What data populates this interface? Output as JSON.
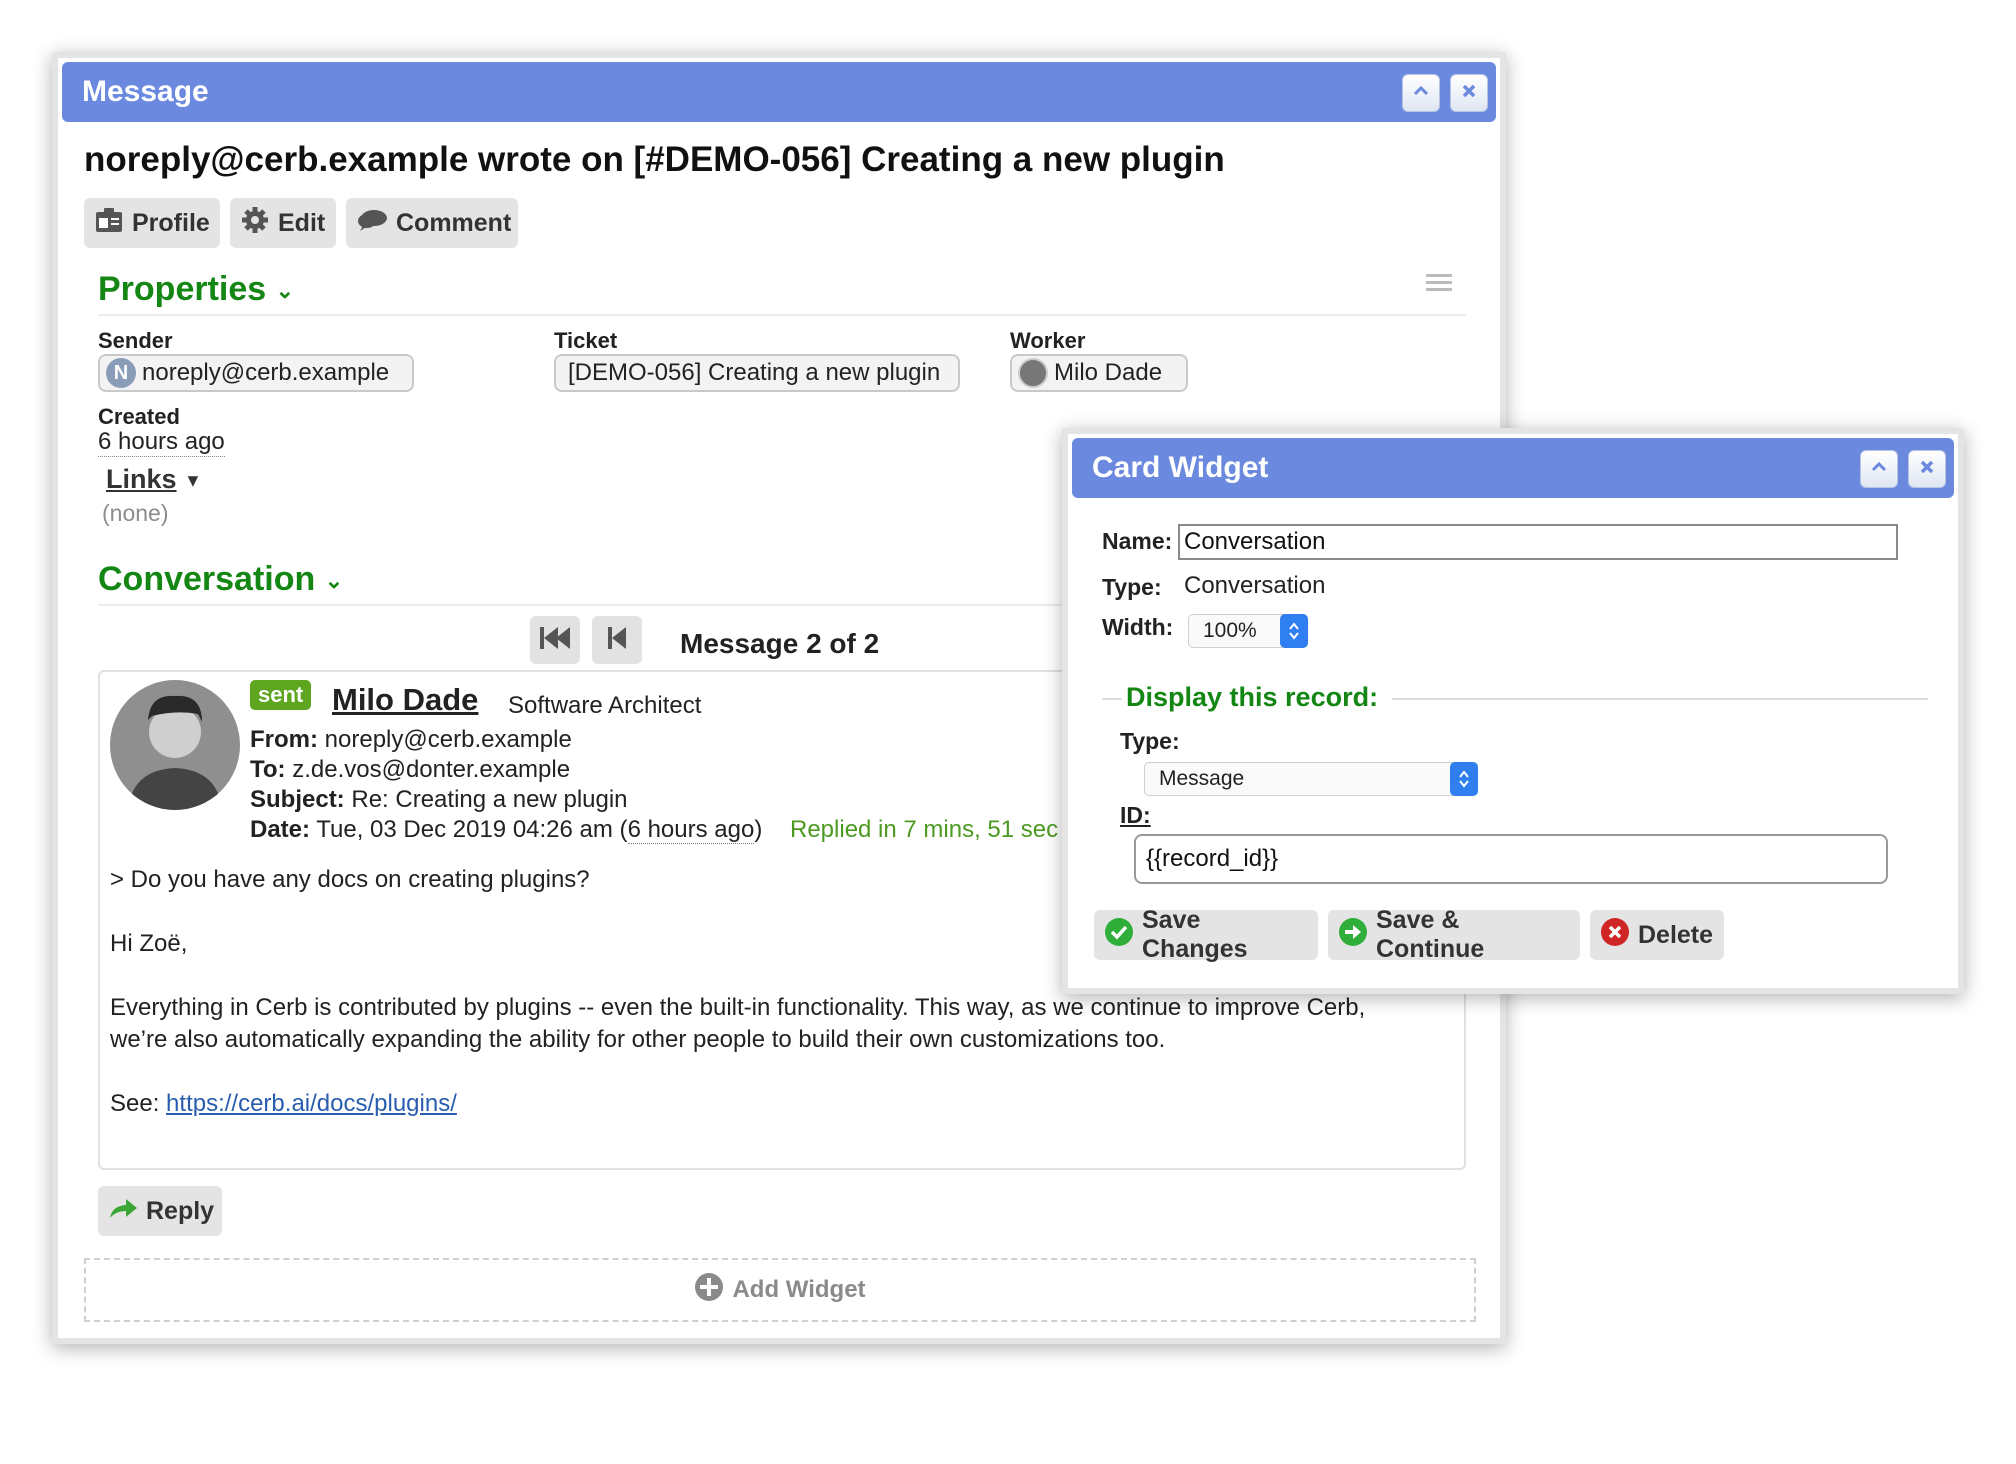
{
  "message_dialog": {
    "title": "Message",
    "heading": "noreply@cerb.example wrote on [#DEMO-056] Creating a new plugin",
    "toolbar": {
      "profile": "Profile",
      "edit": "Edit",
      "comment": "Comment"
    },
    "properties": {
      "section_title": "Properties",
      "sender_label": "Sender",
      "sender_value": "noreply@cerb.example",
      "sender_initial": "N",
      "ticket_label": "Ticket",
      "ticket_value": "[DEMO-056] Creating a new plugin",
      "worker_label": "Worker",
      "worker_value": "Milo Dade",
      "created_label": "Created",
      "created_value": "6 hours ago",
      "links_label": "Links",
      "links_value": "(none)"
    },
    "conversation": {
      "section_title": "Conversation",
      "pager": "Message 2 of 2",
      "message": {
        "badge": "sent",
        "author": "Milo Dade",
        "author_title": "Software Architect",
        "from_label": "From:",
        "from": "noreply@cerb.example",
        "to_label": "To:",
        "to": "z.de.vos@donter.example",
        "subject_label": "Subject:",
        "subject": "Re: Creating a new plugin",
        "date_label": "Date:",
        "date": "Tue, 03 Dec 2019 04:26 am",
        "date_relative": "6 hours ago",
        "replied": "Replied in 7 mins, 51 sec",
        "body_quote": "> Do you have any docs on creating plugins?",
        "body_greeting": "Hi Zoë,",
        "body_line1": "Everything in Cerb is contributed by plugins -- even the built-in functionality. This way, as we continue to improve Cerb,",
        "body_line2": "we’re also automatically expanding the ability for other people to build their own customizations too.",
        "body_see_label": "See:",
        "body_link": "https://cerb.ai/docs/plugins/"
      },
      "reply_label": "Reply"
    },
    "add_widget_label": "Add Widget"
  },
  "widget_dialog": {
    "title": "Card Widget",
    "name_label": "Name:",
    "name_value": "Conversation",
    "type_label": "Type:",
    "type_value": "Conversation",
    "width_label": "Width:",
    "width_value": "100%",
    "display_section": "Display this record:",
    "record_type_label": "Type:",
    "record_type_value": "Message",
    "id_label": "ID:",
    "id_value": "{{record_id}}",
    "save_changes": "Save Changes",
    "save_continue": "Save & Continue",
    "delete": "Delete"
  },
  "colors": {
    "titlebar": "#6b89df",
    "section_green": "#148614",
    "badge_green": "#5ea620",
    "link_blue": "#2a5db0"
  }
}
